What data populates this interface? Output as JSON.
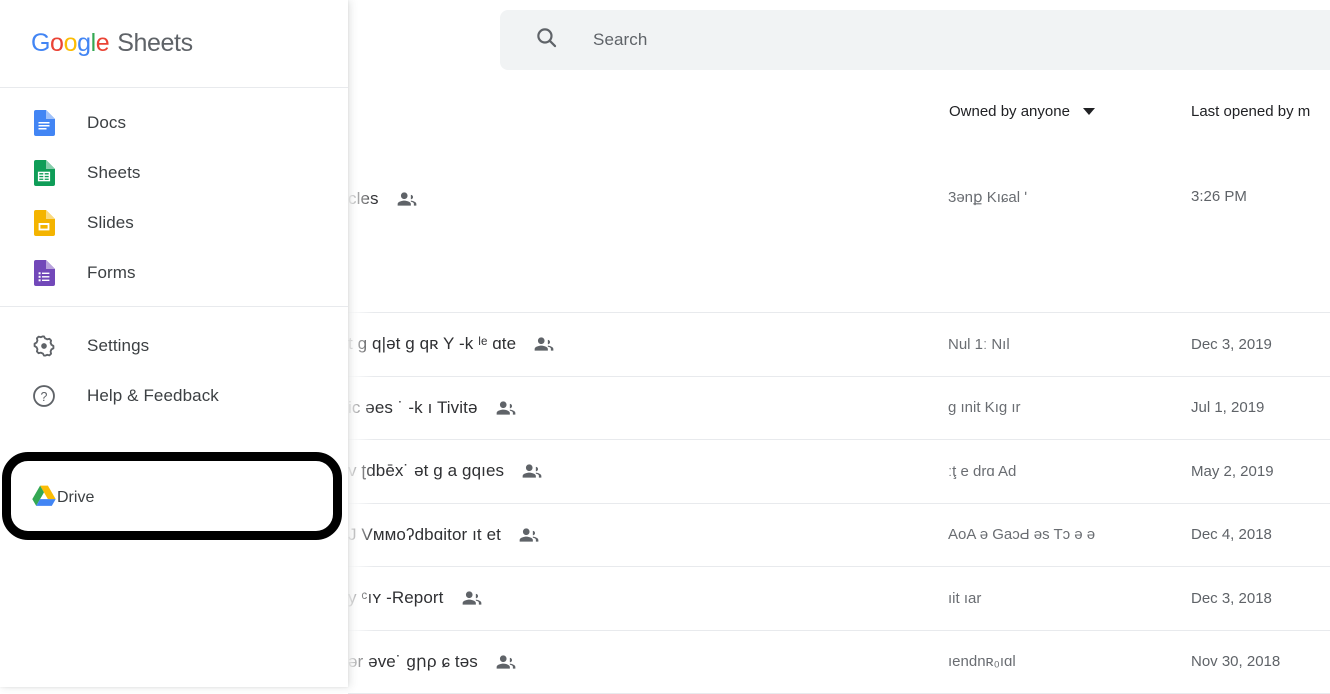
{
  "app": {
    "brand_google": "Google",
    "brand_product": "Sheets"
  },
  "sidebar": {
    "primary_items": [
      {
        "label": "Docs",
        "icon": "docs-icon"
      },
      {
        "label": "Sheets",
        "icon": "sheets-icon"
      },
      {
        "label": "Slides",
        "icon": "slides-icon"
      },
      {
        "label": "Forms",
        "icon": "forms-icon"
      }
    ],
    "secondary_items": [
      {
        "label": "Settings",
        "icon": "gear-icon"
      },
      {
        "label": "Help & Feedback",
        "icon": "help-circle-icon"
      }
    ],
    "highlighted_item": {
      "label": "Drive",
      "icon": "drive-icon",
      "annotation": "black-rounded-box"
    }
  },
  "search": {
    "placeholder": "Search",
    "value": "",
    "icon": "search-icon"
  },
  "list_header": {
    "owner_filter_label": "Owned by anyone",
    "owner_filter_icon": "chevron-down-icon",
    "last_opened_label": "Last opened by m"
  },
  "files": [
    {
      "title_visible": "cles",
      "title_redacted": true,
      "owner_visible": "3ənք Kıɕal ʹ",
      "owner_redacted": true,
      "date": "3:26 PM",
      "shared_icon": "people-shared-icon"
    },
    {
      "title_visible": "t ɡ q|ət ɡ qʀ  Y  -k ˡᵉ  ɑte",
      "title_redacted": true,
      "owner_visible": "Nul 1ː  Nıl",
      "owner_redacted": true,
      "date": "Dec 3, 2019",
      "shared_icon": "people-shared-icon"
    },
    {
      "title_visible": "ic  əes  ˙ -k ı Tivitə",
      "title_redacted": true,
      "owner_visible": "ɡ  ınit Kıɡ  ır",
      "owner_redacted": true,
      "date": "Jul 1, 2019",
      "shared_icon": "people-shared-icon"
    },
    {
      "title_visible": "v ʈdbēх˙  ət ɡ a ɡqıes",
      "title_redacted": true,
      "owner_visible": "ːţ e  drɑ  Ad",
      "owner_redacted": true,
      "date": "May 2, 2019",
      "shared_icon": "people-shared-icon"
    },
    {
      "title_visible": "J Vммoʔdbɑitor  ıt et",
      "title_redacted": true,
      "owner_visible": "AoA ə GaɔԀ əs Tɔ ə ə",
      "owner_redacted": true,
      "date": "Dec 4, 2018",
      "shared_icon": "people-shared-icon"
    },
    {
      "title_visible": "y  ᶜıʏ  -Report",
      "title_redacted": true,
      "owner_visible": "ıit   ıar",
      "owner_redacted": true,
      "date": "Dec 3, 2018",
      "shared_icon": "people-shared-icon"
    },
    {
      "title_visible": "ər  əve˙ ɡրρ ɕ təs",
      "title_redacted": true,
      "owner_visible": "ıendnʀ₀ıɑl",
      "owner_redacted": true,
      "date": "Nov 30, 2018",
      "shared_icon": "people-shared-icon"
    }
  ],
  "colors": {
    "google_blue": "#4285F4",
    "google_red": "#EA4335",
    "google_yellow": "#FBBC05",
    "google_green": "#34A853",
    "docs_blue": "#4285F4",
    "sheets_green": "#0F9D58",
    "slides_yellow": "#F4B400",
    "forms_purple": "#7248B9",
    "search_bg": "#f1f3f4",
    "annotation_black": "#000000",
    "text_primary": "#202124",
    "text_secondary": "#5f6368"
  }
}
